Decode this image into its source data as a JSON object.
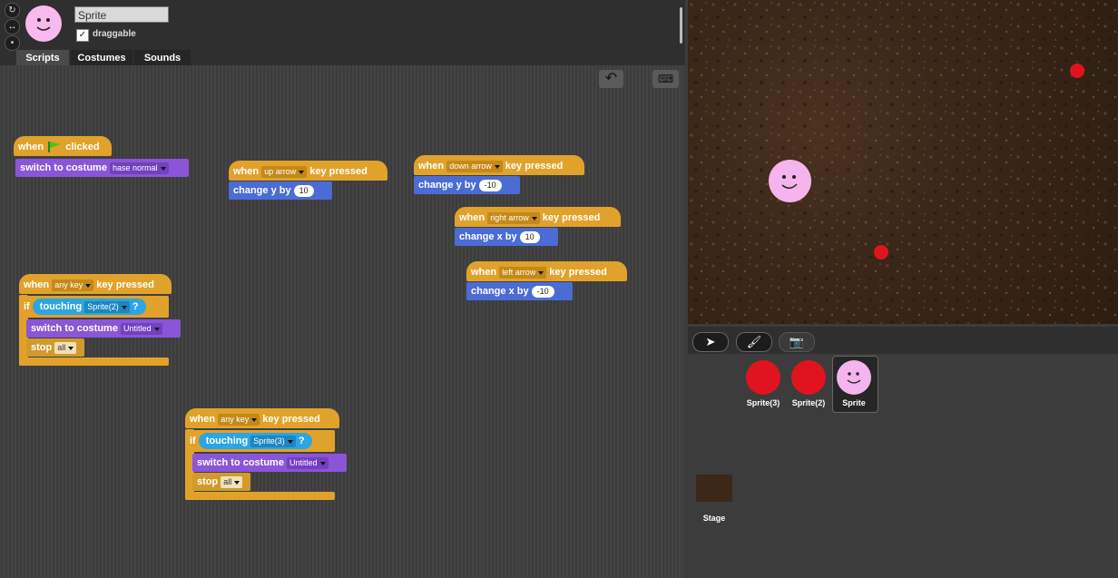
{
  "sprite": {
    "name": "Sprite",
    "draggable_label": "draggable",
    "draggable_checked": "✓"
  },
  "rotation_buttons": [
    "↻",
    "↔",
    "•"
  ],
  "tabs": [
    "Scripts",
    "Costumes",
    "Sounds"
  ],
  "toolbar": {
    "undo_glyph": "↶",
    "keyboard_glyph": "⌨"
  },
  "scripts": {
    "flag": {
      "when": "when",
      "clicked": "clicked",
      "switch": "switch to costume",
      "costume": "hase normal"
    },
    "up": {
      "when": "when",
      "key": "up arrow",
      "pressed": "key pressed",
      "change": "change y by",
      "value": "10"
    },
    "down": {
      "when": "when",
      "key": "down arrow",
      "pressed": "key pressed",
      "change": "change y by",
      "value": "-10"
    },
    "right": {
      "when": "when",
      "key": "right arrow",
      "pressed": "key pressed",
      "change": "change x by",
      "value": "10"
    },
    "left": {
      "when": "when",
      "key": "left arrow",
      "pressed": "key pressed",
      "change": "change x by",
      "value": "-10"
    },
    "any1": {
      "when": "when",
      "key": "any key",
      "pressed": "key pressed",
      "if": "if",
      "touching": "touching",
      "target": "Sprite(2)",
      "q": "?",
      "switch": "switch to costume",
      "costume": "Untitled",
      "stop": "stop",
      "stop_opt": "all"
    },
    "any2": {
      "when": "when",
      "key": "any key",
      "pressed": "key pressed",
      "if": "if",
      "touching": "touching",
      "target": "Sprite(3)",
      "q": "?",
      "switch": "switch to costume",
      "costume": "Untitled",
      "stop": "stop",
      "stop_opt": "all"
    }
  },
  "sprite_tools": [
    "➤",
    "🖌",
    "📷"
  ],
  "corral": [
    {
      "name": "Sprite(3)",
      "color": "#e0141f"
    },
    {
      "name": "Sprite(2)",
      "color": "#e0141f"
    },
    {
      "name": "Sprite",
      "color": "#f5b4ee"
    }
  ],
  "stage_label": "Stage",
  "colors": {
    "motion": "#4a6cd4",
    "looks": "#8a55d7",
    "control": "#e1a22b",
    "sensing": "#2ca5e2",
    "dots": "#e0141f"
  }
}
